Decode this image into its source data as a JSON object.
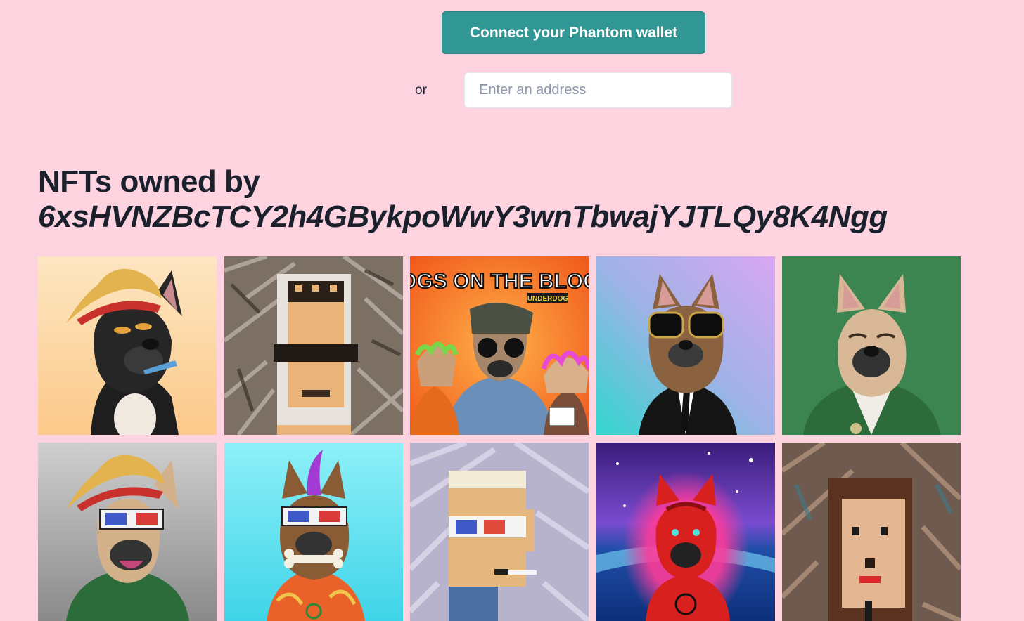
{
  "connect_button_label": "Connect your Phantom wallet",
  "or_label": "or",
  "address_input": {
    "placeholder": "Enter an address",
    "value": ""
  },
  "heading": {
    "prefix": "NFTs owned by",
    "address": "6xsHVNZBcTCY2h4GBykpoWwY3wnTbwajYJTLQy8K4Ngg"
  },
  "album_art": {
    "line1": "DOGS ON THE BLOCK",
    "line2": "UNDERDOG"
  },
  "colors": {
    "background": "#fdd3e0",
    "button": "#319795",
    "text": "#1a202c"
  }
}
